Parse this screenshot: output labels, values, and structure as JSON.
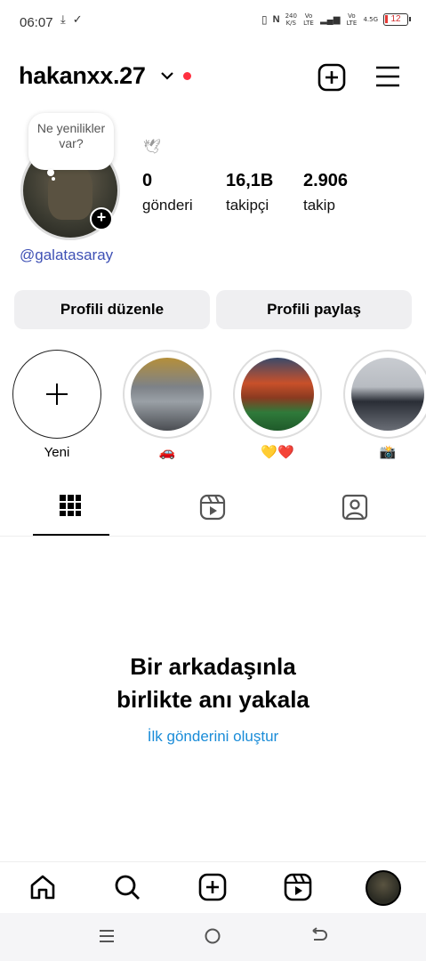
{
  "status_bar": {
    "time": "06:07",
    "net_speed": "240",
    "net_unit": "K/S",
    "vo_lte_1": "Vo LTE",
    "vo_lte_2": "Vo LTE",
    "net_4g": "4.5G",
    "battery": "12",
    "icons": [
      "download-icon",
      "check-download-icon",
      "vibrate-icon",
      "nfc-icon",
      "signal-icon",
      "battery-icon"
    ]
  },
  "header": {
    "username": "hakanxx.27",
    "icons": [
      "chevron-down-icon",
      "notification-dot",
      "create-icon",
      "menu-icon"
    ]
  },
  "profile": {
    "note_text": "Ne yenilikler var?",
    "stats": [
      {
        "value": "0",
        "label": "gönderi"
      },
      {
        "value": "16,1B",
        "label": "takipçi"
      },
      {
        "value": "2.906",
        "label": "takip"
      }
    ],
    "handle": "@galatasaray"
  },
  "buttons": {
    "edit": "Profili düzenle",
    "share": "Profili paylaş"
  },
  "highlights": [
    {
      "label": "Yeni"
    },
    {
      "label": "🚗"
    },
    {
      "label": "💛❤️"
    },
    {
      "label": "📸"
    }
  ],
  "tabs": [
    "grid-icon",
    "reels-icon",
    "tagged-icon"
  ],
  "empty_state": {
    "title_line1": "Bir arkadaşınla",
    "title_line2": "birlikte anı yakala",
    "link": "İlk gönderini oluştur"
  },
  "bottom_nav": [
    "home-icon",
    "search-icon",
    "create-icon",
    "reels-icon",
    "profile-avatar"
  ],
  "colors": {
    "accent_link": "#1a8cd8",
    "handle": "#3f51b5",
    "notification": "#ff3040",
    "button_bg": "#efeff1"
  }
}
